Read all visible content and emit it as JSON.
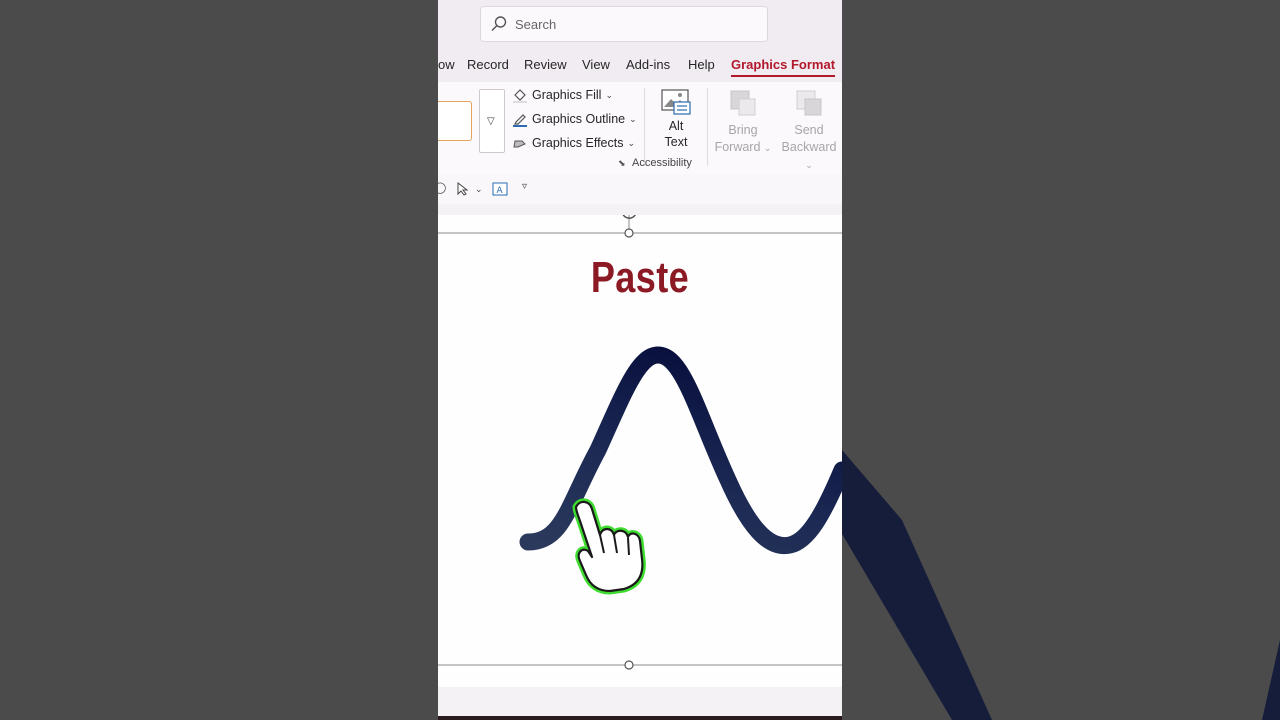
{
  "search": {
    "placeholder": "Search"
  },
  "tabs": [
    {
      "label": "ow"
    },
    {
      "label": "Record"
    },
    {
      "label": "Review"
    },
    {
      "label": "View"
    },
    {
      "label": "Add-ins"
    },
    {
      "label": "Help"
    },
    {
      "label": "Graphics Format",
      "active": true
    }
  ],
  "ribbon": {
    "graphics_fill": "Graphics Fill",
    "graphics_outline": "Graphics Outline",
    "graphics_effects": "Graphics Effects",
    "alt_text_line1": "Alt",
    "alt_text_line2": "Text",
    "accessibility_group": "Accessibility",
    "bring_forward_line1": "Bring",
    "bring_forward_line2": "Forward",
    "send_backward_line1": "Send",
    "send_backward_line2": "Backward"
  },
  "slide": {
    "title": "Paste"
  },
  "colors": {
    "accent": "#b2182b",
    "title": "#8c1a24",
    "wave": "#0b1345",
    "hand_glow": "#3ddc2f"
  },
  "icons": [
    "search-icon",
    "fill-icon",
    "outline-icon",
    "effects-icon",
    "alt-text-icon",
    "bring-forward-icon",
    "send-backward-icon",
    "pointer-icon",
    "textbox-icon",
    "hand-cursor-icon",
    "rotate-handle-icon"
  ]
}
